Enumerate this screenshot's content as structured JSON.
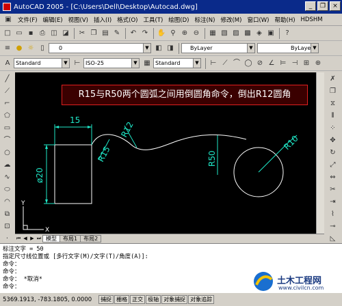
{
  "window": {
    "title": "AutoCAD 2005 - [C:\\Users\\Dell\\Desktop\\Autocad.dwg]",
    "minimize": "_",
    "restore": "❐",
    "close": "×"
  },
  "menu": [
    "文件(F)",
    "编辑(E)",
    "视图(V)",
    "插入(I)",
    "格式(O)",
    "工具(T)",
    "绘图(D)",
    "标注(N)",
    "修改(M)",
    "窗口(W)",
    "帮助(H)",
    "HDSHM"
  ],
  "layer": {
    "value": "0",
    "color_value": "ByLayer",
    "linetype_value": "ByLayer"
  },
  "styles": {
    "text_style": "Standard",
    "dim_style": "ISO-25",
    "table_style": "Standard"
  },
  "annotation": {
    "text": "R15与R50两个圆弧之间用倒圆角命令，倒出R12圆角",
    "border_color": "#e02020"
  },
  "drawing": {
    "color": "#ffffff",
    "dim_color": "#1fe8c8",
    "dims": {
      "width": "15",
      "dia": "ø20",
      "r15": "R15",
      "r12": "R12",
      "r50": "R50",
      "r10": "R10"
    },
    "ucs": {
      "y": "Y",
      "x": "X"
    }
  },
  "tabs": [
    "模型",
    "布局1",
    "布局2"
  ],
  "command_lines": [
    "标注文字 = 50",
    "指定尺寸线位置或 [多行文字(M)/文字(T)/角度(A)]:",
    "命令：",
    "命令：",
    "命令：  *取消*",
    "",
    "命令："
  ],
  "status": {
    "coords": "5369.1913, -783.1805, 0.0000",
    "buttons": [
      "捕捉",
      "栅格",
      "正交",
      "极轴",
      "对象捕捉",
      "对象追踪"
    ]
  },
  "watermark": {
    "text": "土木工程网",
    "url": "www.civilcn.com"
  }
}
